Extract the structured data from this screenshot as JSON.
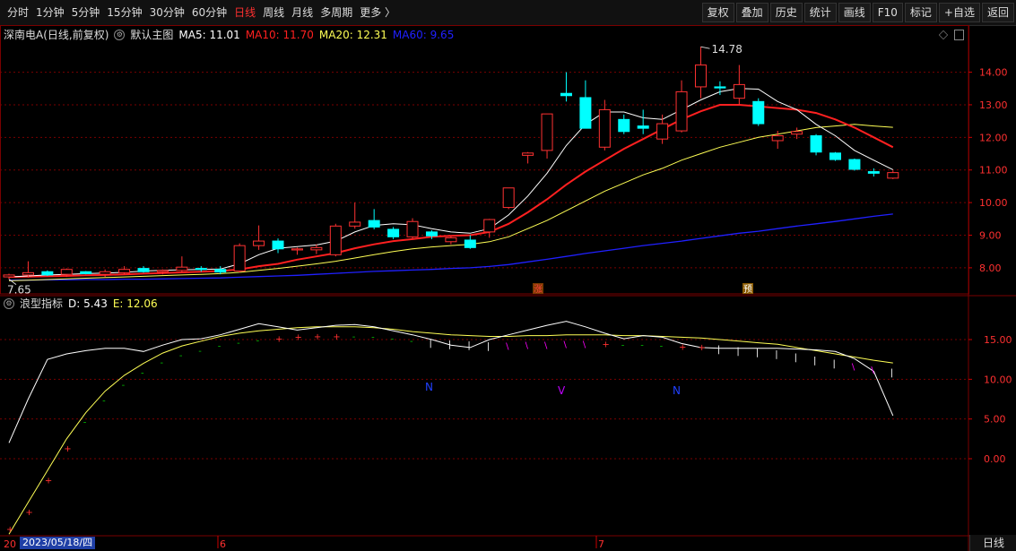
{
  "toolbar": {
    "left_items": [
      "分时",
      "1分钟",
      "5分钟",
      "15分钟",
      "30分钟",
      "60分钟",
      "日线",
      "周线",
      "月线",
      "多周期",
      "更多 〉"
    ],
    "active_item": "日线",
    "right_items": [
      "复权",
      "叠加",
      "历史",
      "统计",
      "画线",
      "F10",
      "标记",
      "+自选",
      "返回"
    ]
  },
  "main_legend": {
    "stock": "深南电A(日线,前复权)",
    "indicator": "默认主图",
    "ma5_label": "MA5: 11.01",
    "ma10_label": "MA10: 11.70",
    "ma20_label": "MA20: 12.31",
    "ma60_label": "MA60: 9.65"
  },
  "sub_legend": {
    "indicator": "浪型指标",
    "d_label": "D: 5.43",
    "e_label": "E: 12.06"
  },
  "annotations": {
    "high": "14.78",
    "low": "7.65",
    "marker1": "涨",
    "marker2": "预",
    "n1": "N",
    "v": "V",
    "n2": "N"
  },
  "x_axis": {
    "date_badge": "2023/05/18/四",
    "left_stub": "20",
    "month6": "6",
    "month7": "7"
  },
  "bottom_tab": "日线",
  "colors": {
    "up": "#ff3232",
    "down": "#00ffff",
    "ma5": "#ffffff",
    "ma10": "#ff2020",
    "ma20": "#ffff55",
    "ma60": "#2020ff",
    "grid": "#7a0000"
  },
  "chart_data": [
    {
      "type": "candlestick",
      "title": "深南电A(日线,前复权)",
      "y_ticks": [
        14.0,
        13.0,
        12.0,
        11.0,
        10.0,
        9.0,
        8.0
      ],
      "ylim": [
        7.2,
        14.95
      ],
      "candles": [
        {
          "o": 7.72,
          "h": 7.82,
          "l": 7.65,
          "c": 7.78
        },
        {
          "o": 7.78,
          "h": 8.2,
          "l": 7.7,
          "c": 7.85
        },
        {
          "o": 7.88,
          "h": 7.92,
          "l": 7.75,
          "c": 7.78
        },
        {
          "o": 7.8,
          "h": 7.98,
          "l": 7.72,
          "c": 7.95
        },
        {
          "o": 7.88,
          "h": 7.9,
          "l": 7.8,
          "c": 7.82
        },
        {
          "o": 7.8,
          "h": 7.95,
          "l": 7.72,
          "c": 7.88
        },
        {
          "o": 7.85,
          "h": 8.05,
          "l": 7.8,
          "c": 7.95
        },
        {
          "o": 7.98,
          "h": 8.05,
          "l": 7.85,
          "c": 7.88
        },
        {
          "o": 7.88,
          "h": 7.95,
          "l": 7.8,
          "c": 7.92
        },
        {
          "o": 7.92,
          "h": 8.35,
          "l": 7.85,
          "c": 8.02
        },
        {
          "o": 7.98,
          "h": 8.05,
          "l": 7.88,
          "c": 7.95
        },
        {
          "o": 7.95,
          "h": 8.05,
          "l": 7.8,
          "c": 7.87
        },
        {
          "o": 7.9,
          "h": 8.75,
          "l": 7.85,
          "c": 8.68
        },
        {
          "o": 8.68,
          "h": 9.3,
          "l": 8.55,
          "c": 8.82
        },
        {
          "o": 8.82,
          "h": 8.9,
          "l": 8.45,
          "c": 8.58
        },
        {
          "o": 8.55,
          "h": 8.62,
          "l": 8.4,
          "c": 8.58
        },
        {
          "o": 8.55,
          "h": 8.72,
          "l": 8.42,
          "c": 8.62
        },
        {
          "o": 8.4,
          "h": 9.35,
          "l": 8.35,
          "c": 9.28
        },
        {
          "o": 9.28,
          "h": 10.0,
          "l": 9.2,
          "c": 9.4
        },
        {
          "o": 9.45,
          "h": 9.8,
          "l": 9.18,
          "c": 9.25
        },
        {
          "o": 9.18,
          "h": 9.25,
          "l": 8.88,
          "c": 8.95
        },
        {
          "o": 8.95,
          "h": 9.52,
          "l": 8.9,
          "c": 9.42
        },
        {
          "o": 9.1,
          "h": 9.15,
          "l": 8.88,
          "c": 8.98
        },
        {
          "o": 8.8,
          "h": 8.98,
          "l": 8.72,
          "c": 8.92
        },
        {
          "o": 8.85,
          "h": 9.0,
          "l": 8.58,
          "c": 8.62
        },
        {
          "o": 9.1,
          "h": 9.5,
          "l": 8.92,
          "c": 9.48
        },
        {
          "o": 9.85,
          "h": 10.45,
          "l": 9.8,
          "c": 10.45
        },
        {
          "o": 11.45,
          "h": 11.55,
          "l": 11.2,
          "c": 11.52
        },
        {
          "o": 11.6,
          "h": 12.72,
          "l": 11.35,
          "c": 12.72
        },
        {
          "o": 13.35,
          "h": 14.0,
          "l": 13.1,
          "c": 13.28
        },
        {
          "o": 13.22,
          "h": 13.75,
          "l": 12.6,
          "c": 12.28
        },
        {
          "o": 11.7,
          "h": 13.15,
          "l": 11.6,
          "c": 12.85
        },
        {
          "o": 12.55,
          "h": 12.7,
          "l": 12.1,
          "c": 12.18
        },
        {
          "o": 12.35,
          "h": 12.85,
          "l": 12.1,
          "c": 12.28
        },
        {
          "o": 11.95,
          "h": 12.7,
          "l": 11.8,
          "c": 12.42
        },
        {
          "o": 12.2,
          "h": 13.75,
          "l": 12.15,
          "c": 13.4
        },
        {
          "o": 13.55,
          "h": 14.78,
          "l": 13.2,
          "c": 14.22
        },
        {
          "o": 13.55,
          "h": 13.72,
          "l": 13.3,
          "c": 13.52
        },
        {
          "o": 13.2,
          "h": 14.22,
          "l": 13.0,
          "c": 13.62
        },
        {
          "o": 13.1,
          "h": 13.2,
          "l": 12.35,
          "c": 12.42
        },
        {
          "o": 11.9,
          "h": 12.2,
          "l": 11.65,
          "c": 12.05
        },
        {
          "o": 12.1,
          "h": 12.3,
          "l": 11.95,
          "c": 12.18
        },
        {
          "o": 12.05,
          "h": 12.1,
          "l": 11.45,
          "c": 11.55
        },
        {
          "o": 11.52,
          "h": 11.55,
          "l": 11.28,
          "c": 11.32
        },
        {
          "o": 11.32,
          "h": 11.35,
          "l": 10.98,
          "c": 11.02
        },
        {
          "o": 10.95,
          "h": 11.05,
          "l": 10.8,
          "c": 10.9
        },
        {
          "o": 10.75,
          "h": 10.98,
          "l": 10.72,
          "c": 10.92
        }
      ],
      "ma5": [
        7.72,
        7.75,
        7.78,
        7.8,
        7.82,
        7.84,
        7.86,
        7.9,
        7.92,
        7.94,
        7.95,
        7.96,
        8.12,
        8.4,
        8.6,
        8.65,
        8.7,
        8.82,
        9.1,
        9.3,
        9.35,
        9.32,
        9.2,
        9.1,
        9.06,
        9.2,
        9.62,
        10.2,
        10.9,
        11.75,
        12.4,
        12.78,
        12.78,
        12.6,
        12.55,
        12.85,
        13.15,
        13.4,
        13.5,
        13.48,
        13.1,
        12.85,
        12.4,
        12.05,
        11.6,
        11.3,
        11.01
      ],
      "ma10": [
        7.72,
        7.73,
        7.74,
        7.75,
        7.77,
        7.78,
        7.8,
        7.82,
        7.84,
        7.86,
        7.88,
        7.9,
        7.95,
        8.05,
        8.12,
        8.25,
        8.35,
        8.45,
        8.6,
        8.72,
        8.82,
        8.88,
        8.95,
        8.98,
        9.0,
        9.1,
        9.35,
        9.7,
        10.1,
        10.55,
        10.95,
        11.3,
        11.65,
        11.95,
        12.25,
        12.55,
        12.8,
        13.0,
        13.0,
        12.95,
        12.9,
        12.85,
        12.75,
        12.55,
        12.3,
        12.0,
        11.7
      ],
      "ma20": [
        7.6,
        7.62,
        7.64,
        7.66,
        7.68,
        7.7,
        7.72,
        7.74,
        7.76,
        7.78,
        7.8,
        7.82,
        7.86,
        7.92,
        7.98,
        8.05,
        8.12,
        8.2,
        8.3,
        8.4,
        8.5,
        8.58,
        8.64,
        8.68,
        8.72,
        8.8,
        8.95,
        9.2,
        9.45,
        9.75,
        10.05,
        10.35,
        10.6,
        10.85,
        11.05,
        11.3,
        11.5,
        11.7,
        11.85,
        12.0,
        12.1,
        12.2,
        12.3,
        12.35,
        12.4,
        12.35,
        12.31
      ],
      "ma60": [
        7.62,
        7.62,
        7.63,
        7.63,
        7.64,
        7.64,
        7.65,
        7.65,
        7.66,
        7.67,
        7.68,
        7.69,
        7.71,
        7.73,
        7.75,
        7.77,
        7.8,
        7.83,
        7.86,
        7.89,
        7.91,
        7.93,
        7.95,
        7.98,
        8.0,
        8.04,
        8.1,
        8.18,
        8.26,
        8.35,
        8.44,
        8.52,
        8.6,
        8.68,
        8.75,
        8.82,
        8.9,
        8.98,
        9.06,
        9.12,
        9.2,
        9.28,
        9.35,
        9.42,
        9.5,
        9.58,
        9.65
      ]
    },
    {
      "type": "line",
      "title": "浪型指标",
      "y_ticks": [
        15.0,
        10.0,
        5.0,
        0.0
      ],
      "ylim": [
        -9.7,
        19.4
      ],
      "D": [
        2.0,
        7.5,
        12.5,
        13.2,
        13.6,
        13.9,
        13.9,
        13.5,
        14.3,
        15.0,
        15.1,
        15.6,
        16.3,
        17.0,
        16.6,
        16.2,
        16.5,
        16.8,
        16.9,
        16.6,
        16.1,
        15.6,
        15.0,
        14.3,
        14.0,
        15.0,
        15.6,
        16.2,
        16.8,
        17.3,
        16.6,
        15.8,
        15.1,
        15.5,
        15.3,
        14.5,
        14.0,
        13.9,
        13.9,
        13.9,
        13.9,
        13.8,
        13.7,
        13.5,
        12.6,
        11.0,
        5.43
      ],
      "E": [
        -9.5,
        -5.5,
        -1.5,
        2.5,
        5.8,
        8.5,
        10.5,
        12.0,
        13.3,
        14.2,
        14.8,
        15.4,
        15.8,
        16.1,
        16.3,
        16.5,
        16.6,
        16.6,
        16.6,
        16.5,
        16.3,
        16.0,
        15.8,
        15.6,
        15.5,
        15.4,
        15.4,
        15.5,
        15.5,
        15.6,
        15.6,
        15.6,
        15.5,
        15.5,
        15.4,
        15.3,
        15.2,
        15.0,
        14.8,
        14.6,
        14.4,
        14.0,
        13.6,
        13.2,
        12.8,
        12.4,
        12.06
      ]
    }
  ]
}
